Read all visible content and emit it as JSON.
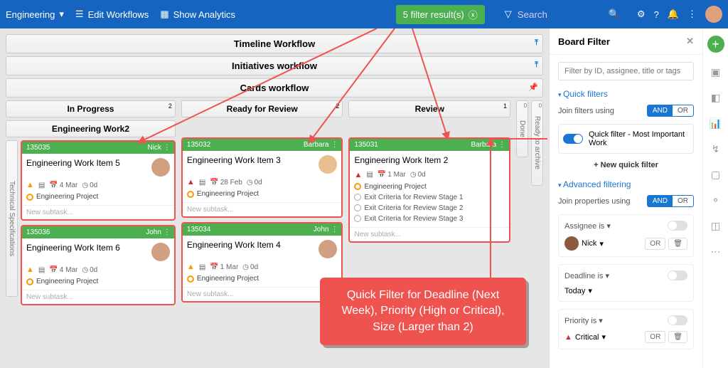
{
  "topbar": {
    "workspace": "Engineering",
    "edit_workflows": "Edit Workflows",
    "show_analytics": "Show Analytics",
    "filter_badge": "5 filter result(s)",
    "search_placeholder": "Search"
  },
  "workflows": {
    "timeline": "Timeline Workflow",
    "initiatives": "Initiatives workflow",
    "cards": "Cards workflow"
  },
  "columns": {
    "in_progress": {
      "label": "In Progress",
      "count": "2",
      "sub_label": "Engineering Work",
      "sub_count": "2"
    },
    "ready_review": {
      "label": "Ready for Review",
      "count": "2"
    },
    "review": {
      "label": "Review",
      "count": "1"
    },
    "done": {
      "label": "Done",
      "count": "0"
    },
    "archive": {
      "label": "Ready to archive",
      "count": "0"
    }
  },
  "cards": [
    {
      "id": "135035",
      "assignee": "Nick",
      "title": "Engineering Work Item 5",
      "priority": "high",
      "date": "4 Mar",
      "elapsed": "0d",
      "project": "Engineering Project",
      "subtask": "New subtask..."
    },
    {
      "id": "135036",
      "assignee": "John",
      "title": "Engineering Work Item 6",
      "priority": "high",
      "date": "4 Mar",
      "elapsed": "0d",
      "project": "Engineering Project",
      "subtask": "New subtask..."
    },
    {
      "id": "135032",
      "assignee": "Barbara",
      "title": "Engineering Work Item 3",
      "priority": "critical",
      "date": "28 Feb",
      "elapsed": "0d",
      "project": "Engineering Project",
      "subtask": "New subtask..."
    },
    {
      "id": "135034",
      "assignee": "John",
      "title": "Engineering Work Item 4",
      "priority": "high",
      "date": "1 Mar",
      "elapsed": "0d",
      "project": "Engineering Project",
      "subtask": "New subtask..."
    },
    {
      "id": "135031",
      "assignee": "Barbara",
      "title": "Engineering Work Item 2",
      "priority": "critical",
      "date": "1 Mar",
      "elapsed": "0d",
      "project": "Engineering Project",
      "exits": [
        "Exit Criteria for Review Stage 1",
        "Exit Criteria for Review Stage 2",
        "Exit Criteria for Review Stage 3"
      ],
      "subtask": "New subtask..."
    }
  ],
  "panel": {
    "title": "Board Filter",
    "search_placeholder": "Filter by ID, assignee, title or tags",
    "quick_filters_label": "Quick filters",
    "join_filters_label": "Join filters using",
    "and": "AND",
    "or": "OR",
    "quick_filter_item": "Quick filter - Most Important Work",
    "new_quick_filter": "New quick filter",
    "advanced_label": "Advanced filtering",
    "join_props_label": "Join properties using",
    "props": {
      "assignee": {
        "label": "Assignee",
        "is": "is",
        "value": "Nick"
      },
      "deadline": {
        "label": "Deadline",
        "is": "is",
        "value": "Today"
      },
      "priority": {
        "label": "Priority",
        "is": "is",
        "value": "Critical"
      }
    },
    "or_btn": "OR"
  },
  "callout": "Quick Filter for Deadline (Next Week), Priority (High or Critical), Size (Larger than 2)"
}
